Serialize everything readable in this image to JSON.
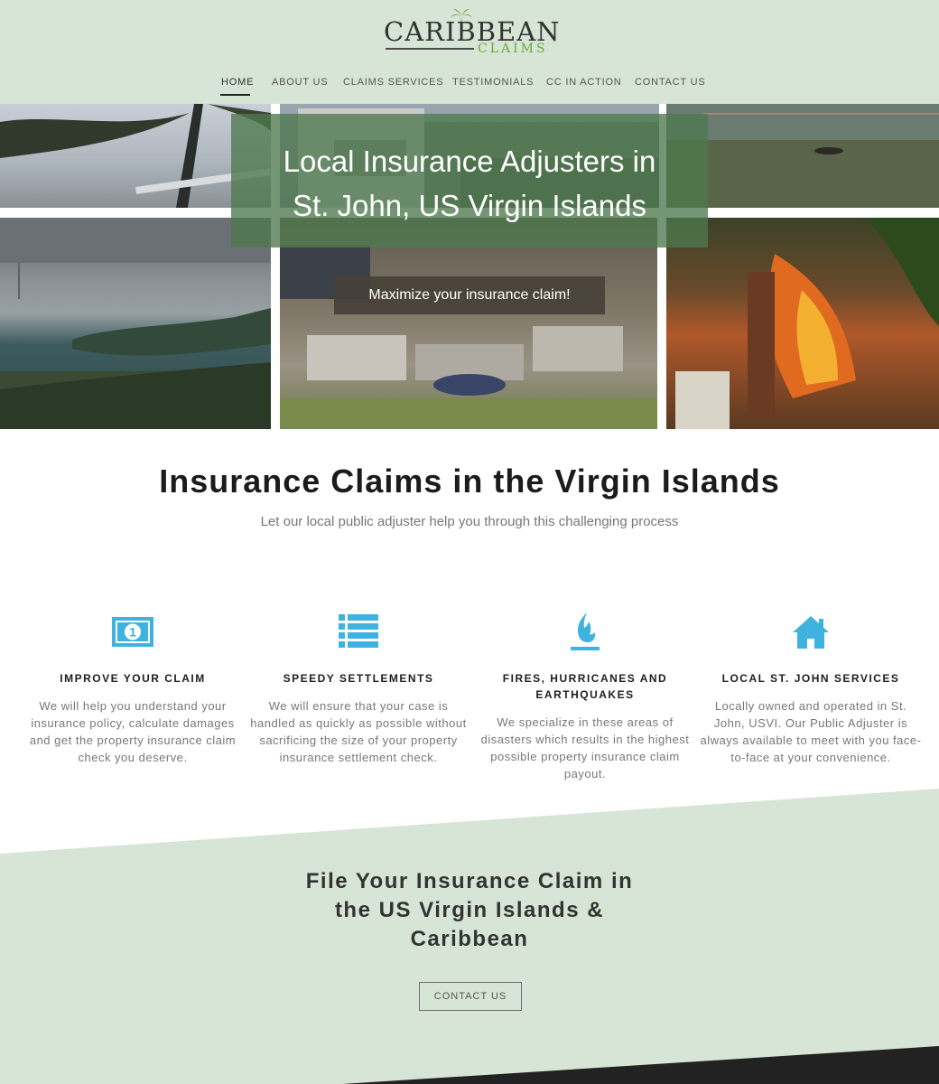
{
  "brand": {
    "logo_main": "CARIBBEAN",
    "logo_sub": "CLAIMS",
    "accent_green": "#6aa83a",
    "header_bg": "#d6e5d6"
  },
  "nav": {
    "items": [
      {
        "label": "HOME",
        "active": true
      },
      {
        "label": "ABOUT US"
      },
      {
        "label": "CLAIMS SERVICES"
      },
      {
        "label": "TESTIMONIALS"
      },
      {
        "label": "CC IN ACTION"
      },
      {
        "label": "CONTACT US"
      }
    ]
  },
  "hero": {
    "title_line1": "Local Insurance Adjusters in",
    "title_line2": "St. John, US Virgin Islands",
    "button_label": "Maximize your insurance claim!"
  },
  "intro": {
    "title": "Insurance Claims in the Virgin Islands",
    "subtitle": "Let our local public adjuster help you through this challenging process"
  },
  "features": [
    {
      "icon": "money-icon",
      "title": "IMPROVE YOUR CLAIM",
      "text": "We will help you understand your insurance policy, calculate damages and get the property insurance claim check you deserve."
    },
    {
      "icon": "list-icon",
      "title": "SPEEDY SETTLEMENTS",
      "text": "We will ensure that your case is handled as quickly as possible without sacrificing the size of your property insurance settlement check."
    },
    {
      "icon": "flame-icon",
      "title_line1": "FIRES, HURRICANES AND",
      "title_line2": "EARTHQUAKES",
      "text": "We specialize in these areas of disasters which results in the highest possible property insurance claim payout."
    },
    {
      "icon": "home-icon",
      "title": "LOCAL ST. JOHN SERVICES",
      "text": "Locally owned and operated in St. John, USVI. Our Public Adjuster is always available to meet with you face-to-face at your convenience."
    }
  ],
  "icon_color": "#3fb3e0",
  "cta": {
    "title_line1": "File Your Insurance Claim in",
    "title_line2": "the US Virgin Islands &",
    "title_line3": "Caribbean",
    "button_label": "CONTACT US"
  }
}
